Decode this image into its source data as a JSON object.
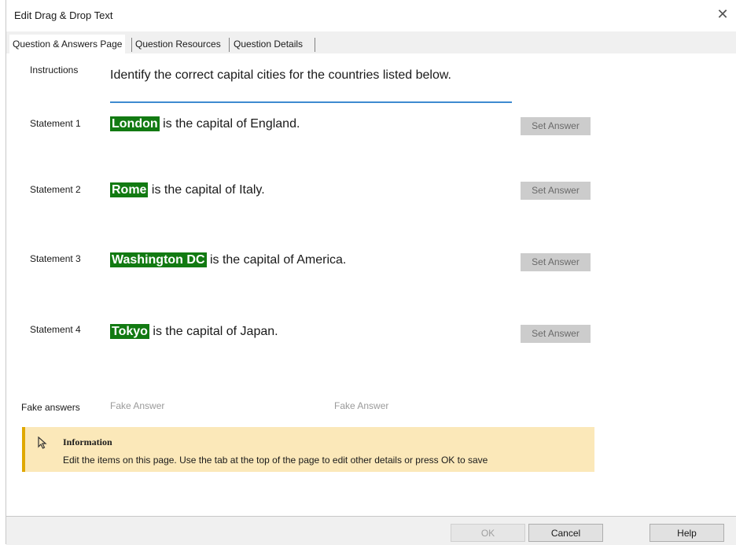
{
  "window": {
    "title": "Edit Drag & Drop Text",
    "close_glyph": "✕"
  },
  "tabs": [
    {
      "label": "Question & Answers Page",
      "active": true
    },
    {
      "label": "Question Resources",
      "active": false
    },
    {
      "label": "Question Details",
      "active": false
    }
  ],
  "instructions": {
    "label": "Instructions",
    "text": "Identify the correct capital cities for the countries listed below."
  },
  "statements": [
    {
      "label": "Statement 1",
      "answer": "London",
      "text": " is the capital of England.",
      "button": "Set Answer"
    },
    {
      "label": "Statement 2",
      "answer": "Rome",
      "text": " is the capital of Italy.",
      "button": "Set Answer"
    },
    {
      "label": "Statement 3",
      "answer": "Washington DC",
      "text": " is the capital of America.",
      "button": "Set Answer"
    },
    {
      "label": "Statement 4",
      "answer": "Tokyo",
      "text": " is the capital of Japan.",
      "button": "Set Answer"
    }
  ],
  "fake_answers": {
    "label": "Fake answers",
    "fields": [
      "Fake Answer",
      "Fake Answer"
    ]
  },
  "info": {
    "icon": "cursor-icon",
    "title": "Information",
    "body": "Edit the items on this page. Use the tab at the top of the page to edit other details or press OK to save"
  },
  "footer": {
    "ok": "OK",
    "cancel": "Cancel",
    "help": "Help"
  },
  "colors": {
    "answer_highlight": "#127a12",
    "info_background": "#fbe8b9",
    "info_accent": "#e0a800",
    "instructions_underline": "#3e8ad0"
  }
}
